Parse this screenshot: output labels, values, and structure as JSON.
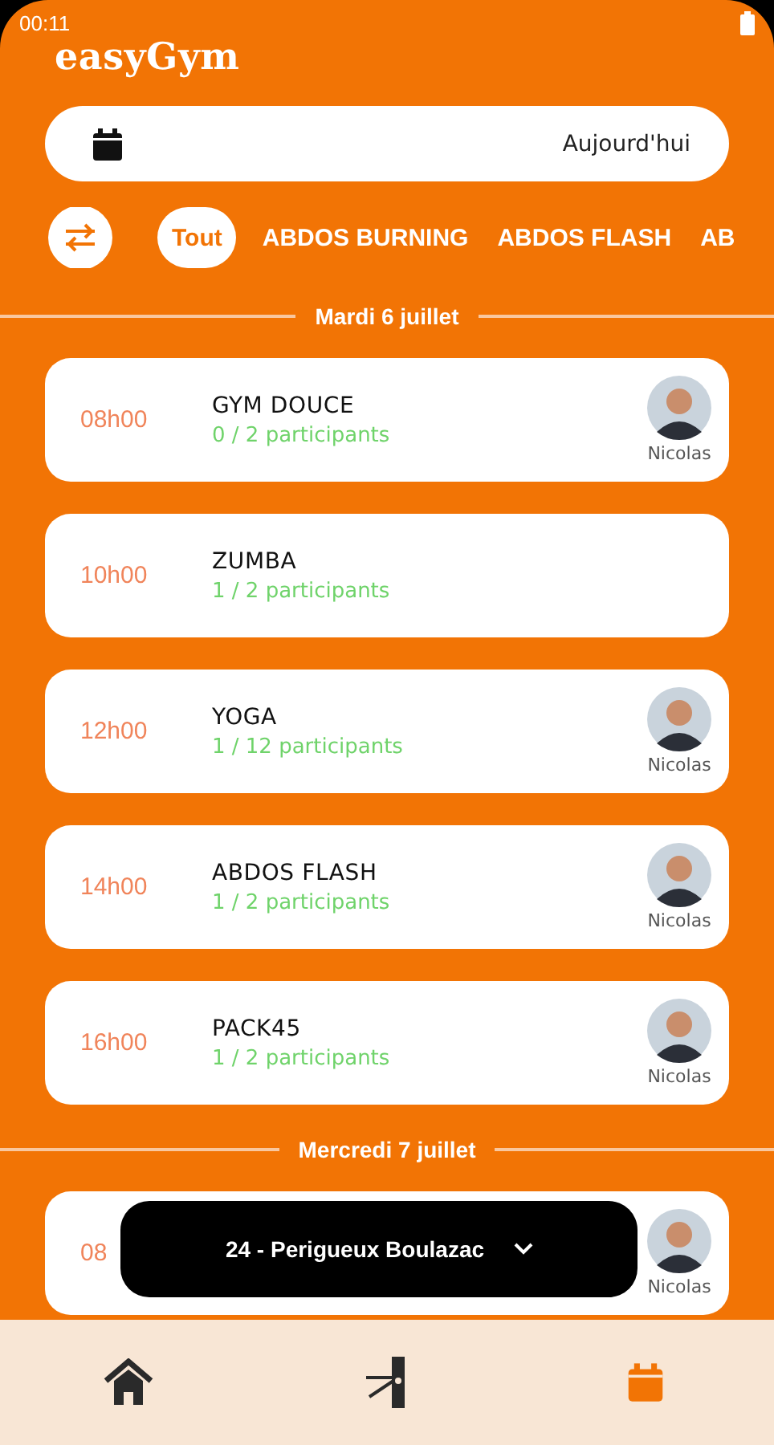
{
  "status_bar": {
    "time": "00:11"
  },
  "app_title": "easyGym",
  "date_field": {
    "value": "Aujourd'hui"
  },
  "filters": [
    {
      "label": "Tout",
      "selected": true
    },
    {
      "label": "ABDOS BURNING",
      "selected": false
    },
    {
      "label": "ABDOS FLASH",
      "selected": false
    },
    {
      "label": "AB",
      "selected": false
    }
  ],
  "days": [
    {
      "title": "Mardi 6 juillet",
      "sessions": [
        {
          "time": "08h00",
          "name": "GYM DOUCE",
          "participants": "0 / 2 participants",
          "coach": "Nicolas"
        },
        {
          "time": "10h00",
          "name": "ZUMBA",
          "participants": "1 / 2 participants"
        },
        {
          "time": "12h00",
          "name": "YOGA",
          "participants": "1 / 12 participants",
          "coach": "Nicolas"
        },
        {
          "time": "14h00",
          "name": "ABDOS FLASH",
          "participants": "1 / 2 participants",
          "coach": "Nicolas"
        },
        {
          "time": "16h00",
          "name": "PACK45",
          "participants": "1 / 2 participants",
          "coach": "Nicolas"
        }
      ]
    },
    {
      "title": "Mercredi 7 juillet",
      "sessions": [
        {
          "time": "08",
          "coach": "Nicolas"
        }
      ]
    }
  ],
  "club_selector": {
    "value": "24 - Perigueux Boulazac"
  },
  "bottom_nav": [
    {
      "kind": "home",
      "selected": false
    },
    {
      "kind": "turnstile",
      "selected": false
    },
    {
      "kind": "calendar",
      "selected": true
    }
  ]
}
